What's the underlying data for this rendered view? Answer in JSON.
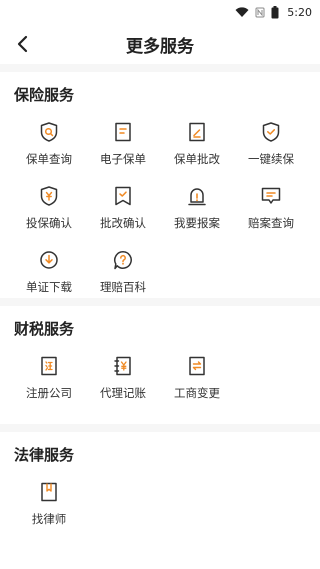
{
  "status_bar": {
    "time": "5:20"
  },
  "header": {
    "title": "更多服务"
  },
  "colors": {
    "accent": "#f08a24",
    "icon_stroke": "#333333",
    "background": "#f6f6f6"
  },
  "sections": [
    {
      "title": "保险服务",
      "items": [
        {
          "label": "保单查询",
          "icon": "shield-search-icon"
        },
        {
          "label": "电子保单",
          "icon": "document-icon"
        },
        {
          "label": "保单批改",
          "icon": "edit-document-icon"
        },
        {
          "label": "一键续保",
          "icon": "shield-check-icon"
        },
        {
          "label": "投保确认",
          "icon": "shield-yen-icon"
        },
        {
          "label": "批改确认",
          "icon": "bookmark-check-icon"
        },
        {
          "label": "我要报案",
          "icon": "alarm-bell-icon"
        },
        {
          "label": "赔案查询",
          "icon": "chat-document-icon"
        },
        {
          "label": "单证下载",
          "icon": "cloud-download-icon"
        },
        {
          "label": "理赔百科",
          "icon": "question-bubble-icon"
        }
      ]
    },
    {
      "title": "财税服务",
      "items": [
        {
          "label": "注册公司",
          "icon": "register-company-icon"
        },
        {
          "label": "代理记账",
          "icon": "ledger-yen-icon"
        },
        {
          "label": "工商变更",
          "icon": "change-document-icon"
        }
      ]
    },
    {
      "title": "法律服务",
      "items": [
        {
          "label": "找律师",
          "icon": "lawyer-book-icon"
        }
      ]
    }
  ]
}
